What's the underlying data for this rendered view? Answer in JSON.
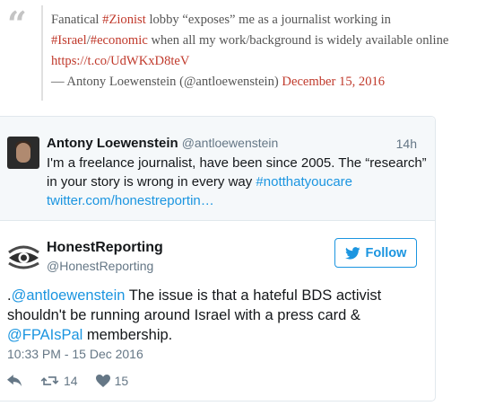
{
  "blockquote": {
    "line1_text": "Fanatical ",
    "line1_tag": "#Zionist",
    "line1_rest": " lobby “exposes” me as a journalist working in",
    "line2_tag1": "#Israel",
    "line2_sep": "/",
    "line2_tag2": "#economic",
    "line2_rest": " when all my work/background is widely available online",
    "link": "https://t.co/UdWKxD8teV",
    "attribution": "— Antony Loewenstein (@antloewenstein) ",
    "date": "December 15, 2016"
  },
  "quoted_tweet": {
    "name": "Antony Loewenstein",
    "handle": "@antloewenstein",
    "time": "14h",
    "text": "I'm a freelance journalist, have been since 2005. The “research” in your story is wrong in every way ",
    "hashtag": "#notthatyoucare",
    "link": "twitter.com/honestreportin…"
  },
  "tweet": {
    "author_name": "HonestReporting",
    "author_handle": "@HonestReporting",
    "follow_label": "Follow",
    "text_prefix": ".",
    "mention1": "@antloewenstein",
    "text_mid": " The issue is that a hateful BDS activist shouldn't be running around Israel with a press card & ",
    "mention2": "@FPAIsPal",
    "text_end": " membership.",
    "timestamp": "10:33 PM - 15 Dec 2016",
    "retweet_count": "14",
    "like_count": "15"
  },
  "icons": {
    "quote": "quote-mark-icon",
    "reply": "reply-icon",
    "retweet": "retweet-icon",
    "like": "heart-icon",
    "twitter": "twitter-bird-icon",
    "logo": "honestreporting-eye-logo"
  },
  "colors": {
    "link_red": "#c0392b",
    "twitter_blue": "#1b95e0",
    "muted_gray": "#657786"
  }
}
